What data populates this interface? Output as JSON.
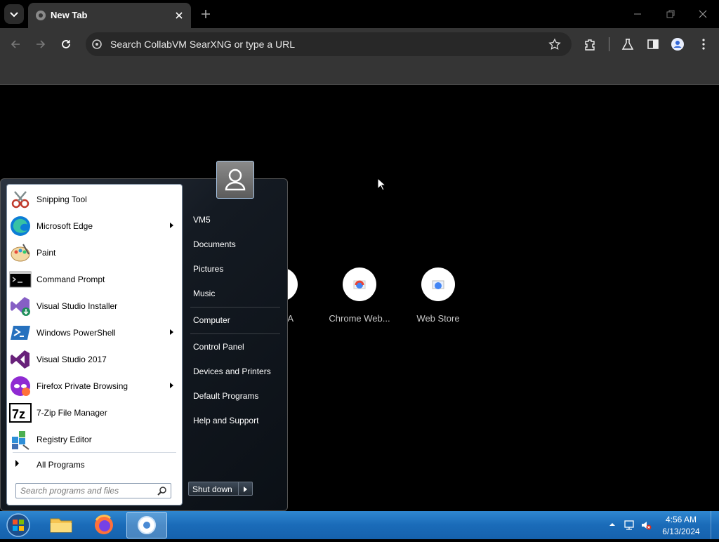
{
  "browser": {
    "tab": {
      "title": "New Tab"
    },
    "omnibox": {
      "placeholder": "Search CollabVM SearXNG or type a URL"
    },
    "shortcuts": [
      {
        "label": "A"
      },
      {
        "label": "Chrome Web..."
      },
      {
        "label": "Web Store"
      }
    ]
  },
  "start_menu": {
    "programs": [
      {
        "label": "Snipping Tool",
        "icon": "snipping-tool-icon",
        "submenu": false
      },
      {
        "label": "Microsoft Edge",
        "icon": "edge-icon",
        "submenu": true
      },
      {
        "label": "Paint",
        "icon": "paint-icon",
        "submenu": false
      },
      {
        "label": "Command Prompt",
        "icon": "command-prompt-icon",
        "submenu": false
      },
      {
        "label": "Visual Studio Installer",
        "icon": "vs-installer-icon",
        "submenu": false
      },
      {
        "label": "Windows PowerShell",
        "icon": "powershell-icon",
        "submenu": true
      },
      {
        "label": "Visual Studio 2017",
        "icon": "visual-studio-icon",
        "submenu": false
      },
      {
        "label": "Firefox Private Browsing",
        "icon": "firefox-private-icon",
        "submenu": true
      },
      {
        "label": "7-Zip File Manager",
        "icon": "7zip-icon",
        "submenu": false
      },
      {
        "label": "Registry Editor",
        "icon": "registry-editor-icon",
        "submenu": false
      }
    ],
    "all_programs": "All Programs",
    "search_placeholder": "Search programs and files",
    "right_items": {
      "vm": "VM5",
      "documents": "Documents",
      "pictures": "Pictures",
      "music": "Music",
      "computer": "Computer",
      "control_panel": "Control Panel",
      "devices": "Devices and Printers",
      "default_programs": "Default Programs",
      "help": "Help and Support"
    },
    "shutdown": "Shut down"
  },
  "taskbar": {
    "apps": [
      "file-explorer-icon",
      "firefox-icon",
      "chrome-icon"
    ],
    "time": "4:56 AM",
    "date": "6/13/2024"
  }
}
